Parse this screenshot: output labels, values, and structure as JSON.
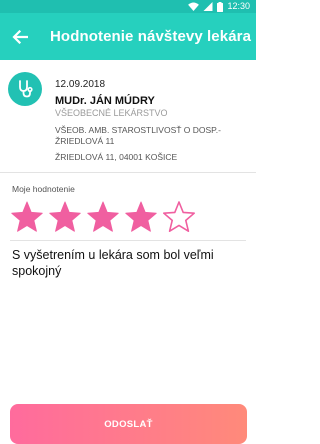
{
  "status_bar": {
    "time": "12:30",
    "icons": [
      "wifi-icon",
      "signal-icon",
      "battery-icon"
    ]
  },
  "app_bar": {
    "title": "Hodnotenie návštevy lekára",
    "back_icon": "arrow-left-icon"
  },
  "visit": {
    "date": "12.09.2018",
    "doctor_name": "MUDr. JÁN MÚDRY",
    "specialty": "VŠEOBECNÉ LEKÁRSTVO",
    "facility": "VŠEOB. AMB. STAROSTLIVOSŤ O DOSP.- ŽRIEDLOVÁ 11",
    "address": "ŽRIEDLOVÁ 11, 04001 KOŠICE",
    "avatar_icon": "stethoscope-icon"
  },
  "rating": {
    "label": "Moje hodnotenie",
    "value": 4,
    "max": 5
  },
  "comment": {
    "text": "S vyšetrením u lekára som bol veľmi spokojný"
  },
  "submit": {
    "label": "ODOSLAŤ"
  },
  "colors": {
    "status_bar": "#1fbfb0",
    "app_bar": "#26d0be",
    "avatar": "#22c1b3",
    "star": "#f05fa0",
    "button_start": "#ff6b9d",
    "button_end": "#ff8a7a"
  }
}
